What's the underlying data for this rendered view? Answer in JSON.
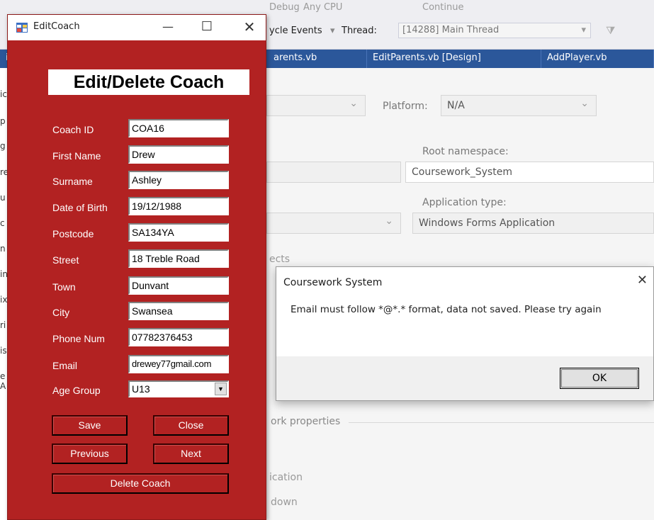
{
  "vs": {
    "toolbar": {
      "debug": "Debug",
      "cpu": "Any CPU",
      "continue": "Continue",
      "lifecycle": "ycle Events",
      "thread_label": "Thread:",
      "thread_value": "[14288] Main Thread"
    },
    "tabs": [
      "arents.vb",
      "EditParents.vb [Design]",
      "AddPlayer.vb"
    ],
    "sidebar": [
      "ic",
      "p",
      "g",
      "re",
      "u",
      "c",
      "n",
      "in",
      "ix",
      "ri",
      "is",
      "e A"
    ],
    "platform_label": "Platform:",
    "platform_value": "N/A",
    "root_ns_label": "Root namespace:",
    "root_ns_value": "Coursework_System",
    "app_type_label": "Application type:",
    "app_type_value": "Windows Forms Application",
    "frag_rects": "ects",
    "frag_framework": "ork properties",
    "frag_ication": "ication",
    "frag_down": "down"
  },
  "form": {
    "title": "EditCoach",
    "heading": "Edit/Delete Coach",
    "fields": [
      {
        "label": "Coach ID",
        "value": "COA16"
      },
      {
        "label": "First Name",
        "value": "Drew"
      },
      {
        "label": "Surname",
        "value": "Ashley"
      },
      {
        "label": "Date of Birth",
        "value": "19/12/1988"
      },
      {
        "label": "Postcode",
        "value": "SA134YA"
      },
      {
        "label": "Street",
        "value": "18 Treble Road"
      },
      {
        "label": "Town",
        "value": "Dunvant"
      },
      {
        "label": "City",
        "value": "Swansea"
      },
      {
        "label": "Phone Num",
        "value": "07782376453"
      },
      {
        "label": "Email",
        "value": "drewey77gmail.com"
      }
    ],
    "age_group": {
      "label": "Age Group",
      "value": "U13"
    },
    "buttons": {
      "save": "Save",
      "close": "Close",
      "previous": "Previous",
      "next": "Next",
      "delete": "Delete Coach"
    },
    "colors": {
      "background": "#b22222"
    }
  },
  "dialog": {
    "title": "Coursework System",
    "message": "Email must follow *@*.* format, data not saved. Please try again",
    "ok": "OK"
  }
}
